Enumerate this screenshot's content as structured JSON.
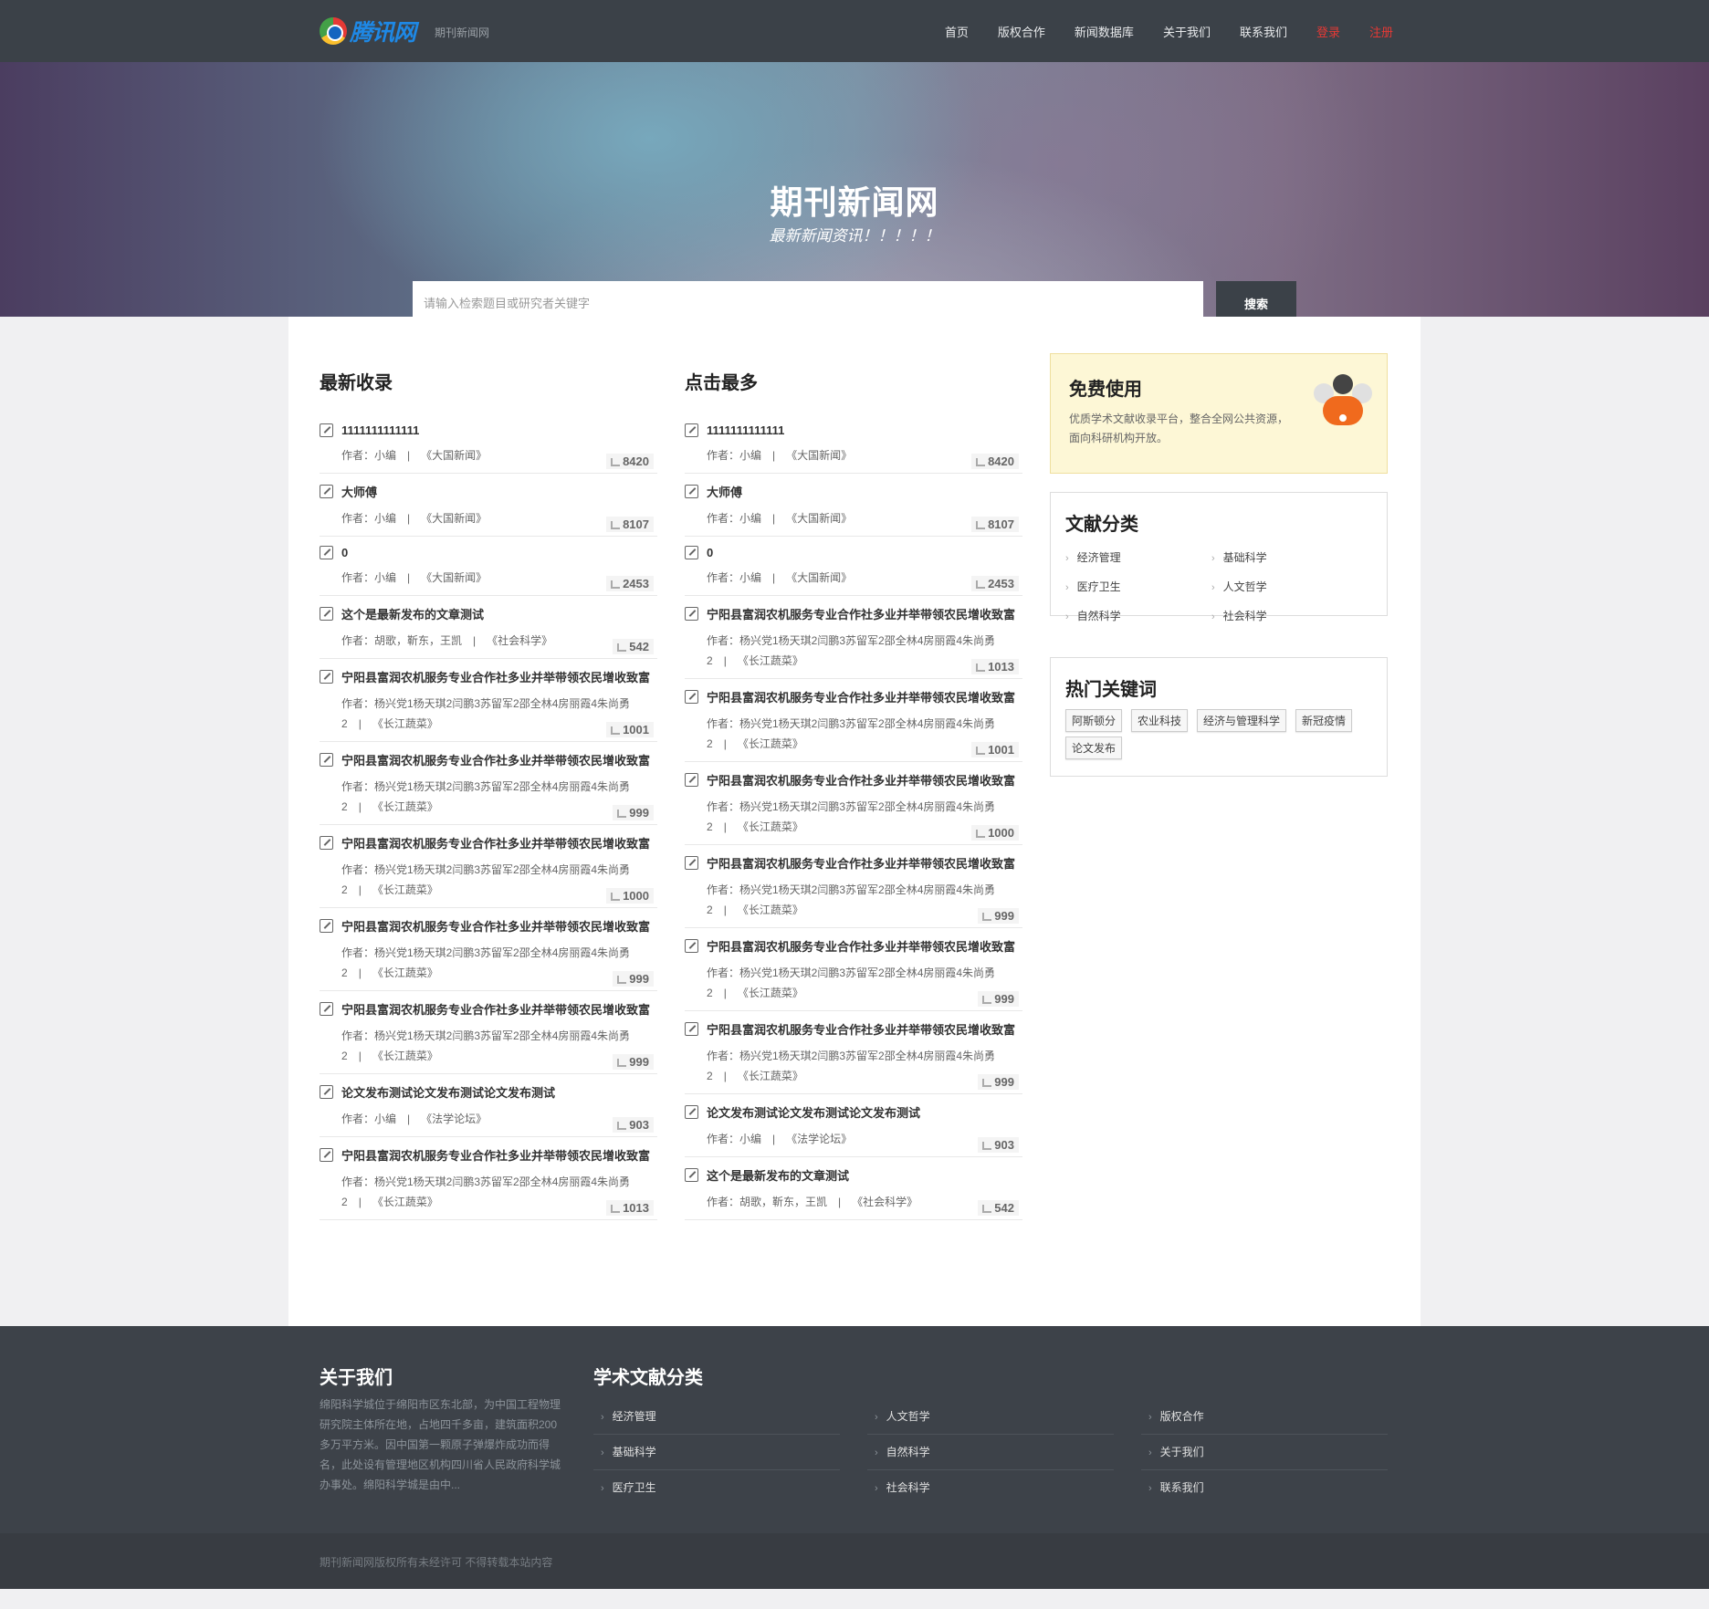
{
  "header": {
    "logo_text": "腾讯网",
    "site_sub": "期刊新闻网",
    "nav": [
      {
        "label": "首页",
        "red": false
      },
      {
        "label": "版权合作",
        "red": false
      },
      {
        "label": "新闻数据库",
        "red": false
      },
      {
        "label": "关于我们",
        "red": false
      },
      {
        "label": "联系我们",
        "red": false
      },
      {
        "label": "登录",
        "red": true
      },
      {
        "label": "注册",
        "red": true
      }
    ]
  },
  "hero": {
    "title": "期刊新闻网",
    "subtitle": "最新新闻资讯！！！！！",
    "search_placeholder": "请输入检索题目或研究者关键字",
    "search_button": "搜索"
  },
  "latest": {
    "title": "最新收录",
    "items": [
      {
        "title": "1111111111111",
        "meta1": "作者：小编",
        "meta2": "《大国新闻》",
        "count": "8420"
      },
      {
        "title": "大师傅",
        "meta1": "作者：小编",
        "meta2": "《大国新闻》",
        "count": "8107"
      },
      {
        "title": "0",
        "meta1": "作者：小编",
        "meta2": "《大国新闻》",
        "count": "2453"
      },
      {
        "title": "这个是最新发布的文章测试",
        "meta1": "作者：胡歌，靳东，王凯",
        "meta2": "《社会科学》",
        "count": "542"
      },
      {
        "title": "宁阳县富润农机服务专业合作社多业并举带领农民增收致富",
        "meta1": "作者：杨兴党1杨天琪2闫鹏3苏留军2邵全林4房丽霞4朱尚勇2",
        "meta2": "《长江蔬菜》",
        "count": "1001"
      },
      {
        "title": "宁阳县富润农机服务专业合作社多业并举带领农民增收致富",
        "meta1": "作者：杨兴党1杨天琪2闫鹏3苏留军2邵全林4房丽霞4朱尚勇2",
        "meta2": "《长江蔬菜》",
        "count": "999"
      },
      {
        "title": "宁阳县富润农机服务专业合作社多业并举带领农民增收致富",
        "meta1": "作者：杨兴党1杨天琪2闫鹏3苏留军2邵全林4房丽霞4朱尚勇2",
        "meta2": "《长江蔬菜》",
        "count": "1000"
      },
      {
        "title": "宁阳县富润农机服务专业合作社多业并举带领农民增收致富",
        "meta1": "作者：杨兴党1杨天琪2闫鹏3苏留军2邵全林4房丽霞4朱尚勇2",
        "meta2": "《长江蔬菜》",
        "count": "999"
      },
      {
        "title": "宁阳县富润农机服务专业合作社多业并举带领农民增收致富",
        "meta1": "作者：杨兴党1杨天琪2闫鹏3苏留军2邵全林4房丽霞4朱尚勇2",
        "meta2": "《长江蔬菜》",
        "count": "999"
      },
      {
        "title": "论文发布测试论文发布测试论文发布测试",
        "meta1": "作者：小编",
        "meta2": "《法学论坛》",
        "count": "903"
      },
      {
        "title": "宁阳县富润农机服务专业合作社多业并举带领农民增收致富",
        "meta1": "作者：杨兴党1杨天琪2闫鹏3苏留军2邵全林4房丽霞4朱尚勇2",
        "meta2": "《长江蔬菜》",
        "count": "1013"
      }
    ]
  },
  "popular": {
    "title": "点击最多",
    "items": [
      {
        "title": "1111111111111",
        "meta1": "作者：小编",
        "meta2": "《大国新闻》",
        "count": "8420"
      },
      {
        "title": "大师傅",
        "meta1": "作者：小编",
        "meta2": "《大国新闻》",
        "count": "8107"
      },
      {
        "title": "0",
        "meta1": "作者：小编",
        "meta2": "《大国新闻》",
        "count": "2453"
      },
      {
        "title": "宁阳县富润农机服务专业合作社多业并举带领农民增收致富",
        "meta1": "作者：杨兴党1杨天琪2闫鹏3苏留军2邵全林4房丽霞4朱尚勇2",
        "meta2": "《长江蔬菜》",
        "count": "1013"
      },
      {
        "title": "宁阳县富润农机服务专业合作社多业并举带领农民增收致富",
        "meta1": "作者：杨兴党1杨天琪2闫鹏3苏留军2邵全林4房丽霞4朱尚勇2",
        "meta2": "《长江蔬菜》",
        "count": "1001"
      },
      {
        "title": "宁阳县富润农机服务专业合作社多业并举带领农民增收致富",
        "meta1": "作者：杨兴党1杨天琪2闫鹏3苏留军2邵全林4房丽霞4朱尚勇2",
        "meta2": "《长江蔬菜》",
        "count": "1000"
      },
      {
        "title": "宁阳县富润农机服务专业合作社多业并举带领农民增收致富",
        "meta1": "作者：杨兴党1杨天琪2闫鹏3苏留军2邵全林4房丽霞4朱尚勇2",
        "meta2": "《长江蔬菜》",
        "count": "999"
      },
      {
        "title": "宁阳县富润农机服务专业合作社多业并举带领农民增收致富",
        "meta1": "作者：杨兴党1杨天琪2闫鹏3苏留军2邵全林4房丽霞4朱尚勇2",
        "meta2": "《长江蔬菜》",
        "count": "999"
      },
      {
        "title": "宁阳县富润农机服务专业合作社多业并举带领农民增收致富",
        "meta1": "作者：杨兴党1杨天琪2闫鹏3苏留军2邵全林4房丽霞4朱尚勇2",
        "meta2": "《长江蔬菜》",
        "count": "999"
      },
      {
        "title": "论文发布测试论文发布测试论文发布测试",
        "meta1": "作者：小编",
        "meta2": "《法学论坛》",
        "count": "903"
      },
      {
        "title": "这个是最新发布的文章测试",
        "meta1": "作者：胡歌，靳东，王凯",
        "meta2": "《社会科学》",
        "count": "542"
      }
    ]
  },
  "sidebar": {
    "free": {
      "title": "免费使用",
      "desc": "优质学术文献收录平台，整合全网公共资源，面向科研机构开放。"
    },
    "categories": {
      "title": "文献分类",
      "items": [
        "经济管理",
        "基础科学",
        "医疗卫生",
        "人文哲学",
        "自然科学",
        "社会科学"
      ]
    },
    "keywords": {
      "title": "热门关键词",
      "tags": [
        "阿斯顿分",
        "农业科技",
        "经济与管理科学",
        "新冠疫情",
        "论文发布"
      ]
    }
  },
  "footer": {
    "about_title": "关于我们",
    "about_text": "绵阳科学城位于绵阳市区东北部，为中国工程物理研究院主体所在地，占地四千多亩，建筑面积200多万平方米。因中国第一颗原子弹爆炸成功而得名，此处设有管理地区机构四川省人民政府科学城办事处。绵阳科学城是由中...",
    "cat_title": "学术文献分类",
    "col1": [
      "经济管理",
      "基础科学",
      "医疗卫生"
    ],
    "col2": [
      "人文哲学",
      "自然科学",
      "社会科学"
    ],
    "col3": [
      "版权合作",
      "关于我们",
      "联系我们"
    ],
    "copyright": "期刊新闻网版权所有未经许可 不得转载本站内容"
  }
}
